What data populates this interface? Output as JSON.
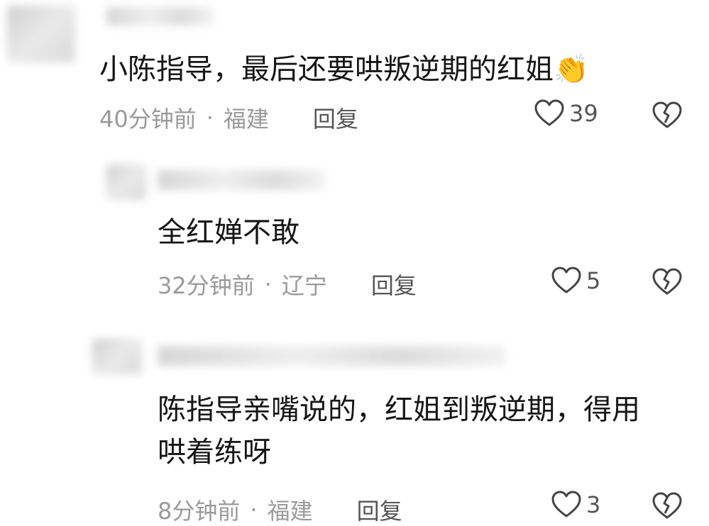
{
  "comments": [
    {
      "text": "小陈指导，最后还要哄叛逆期的红姐",
      "emoji": "👏",
      "time": "40分钟前",
      "location": "福建",
      "reply_label": "回复",
      "likes": "39"
    },
    {
      "text": "全红婵不敢",
      "time": "32分钟前",
      "location": "辽宁",
      "reply_label": "回复",
      "likes": "5"
    },
    {
      "text_line1": "陈指导亲嘴说的，红姐到叛逆期，得用",
      "text_line2": "哄着练呀",
      "time": "8分钟前",
      "location": "福建",
      "reply_label": "回复",
      "likes": "3"
    }
  ],
  "separator": "·",
  "icons": {
    "like": "heart-outline-icon",
    "dislike": "broken-heart-icon"
  },
  "colors": {
    "text": "#161616",
    "meta": "#9a9a9a",
    "reply": "#555555",
    "icon": "#444444"
  }
}
